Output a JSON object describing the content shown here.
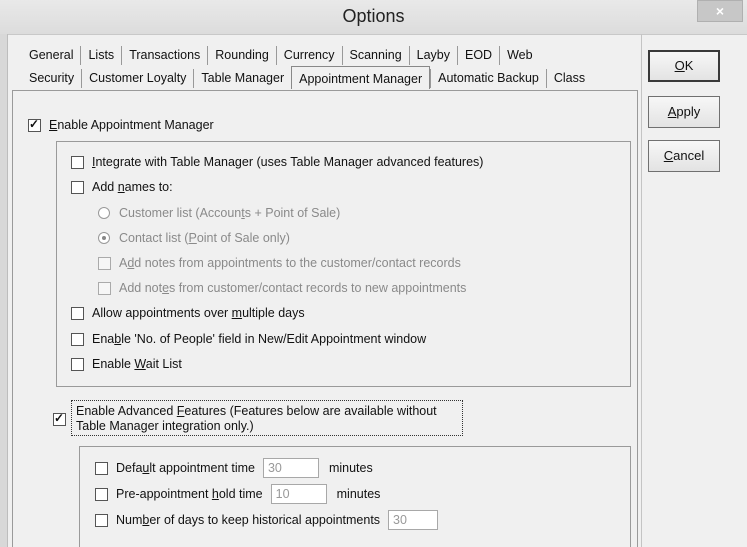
{
  "window": {
    "title": "Options",
    "close_label": "×"
  },
  "tabs_row1": [
    "General",
    "Lists",
    "Transactions",
    "Rounding",
    "Currency",
    "Scanning",
    "Layby",
    "EOD",
    "Web"
  ],
  "tabs_row2": [
    "Security",
    "Customer Loyalty",
    "Table Manager",
    "Appointment Manager",
    "Automatic Backup",
    "Class"
  ],
  "active_tab": "Appointment Manager",
  "buttons": {
    "ok_pre": "",
    "ok_u": "O",
    "ok_post": "K",
    "apply_pre": "",
    "apply_u": "A",
    "apply_post": "pply",
    "cancel_pre": "",
    "cancel_u": "C",
    "cancel_post": "ancel"
  },
  "enable_appt": {
    "checked": true,
    "pre": "",
    "u": "E",
    "post": "nable Appointment Manager"
  },
  "integrate": {
    "checked": false,
    "pre": "",
    "u": "I",
    "post": "ntegrate with Table Manager (uses Table Manager advanced features)"
  },
  "add_names": {
    "checked": false,
    "pre": "Add ",
    "u": "n",
    "post": "ames to:"
  },
  "customer_list": {
    "selected": false,
    "pre": "Customer list (Accoun",
    "u": "t",
    "post": "s + Point of Sale)"
  },
  "contact_list": {
    "selected": true,
    "pre": "Contact list (",
    "u": "P",
    "post": "oint of Sale only)"
  },
  "notes_to_records": {
    "checked": false,
    "pre": "A",
    "u": "d",
    "post": "d notes from appointments to the customer/contact records"
  },
  "notes_from_records": {
    "checked": false,
    "pre": "Add not",
    "u": "e",
    "post": "s from customer/contact records to new appointments"
  },
  "multi_days": {
    "checked": false,
    "pre": "Allow appointments over ",
    "u": "m",
    "post": "ultiple days"
  },
  "no_people": {
    "checked": false,
    "pre": "Ena",
    "u": "b",
    "post": "le 'No. of People' field in New/Edit Appointment window"
  },
  "wait_list": {
    "checked": false,
    "pre": "Enable ",
    "u": "W",
    "post": "ait List"
  },
  "advanced": {
    "checked": true,
    "line1_pre": "Enable Advanced ",
    "line1_u": "F",
    "line1_post": "eatures (Features below are available without",
    "line2": "Table Manager integration only.)"
  },
  "default_time": {
    "checked": false,
    "pre": "Defa",
    "u": "u",
    "post": "lt appointment time",
    "value": "30",
    "unit": "minutes"
  },
  "hold_time": {
    "checked": false,
    "pre": "Pre-appointment ",
    "u": "h",
    "post": "old time",
    "value": "10",
    "unit": "minutes"
  },
  "history_days": {
    "checked": false,
    "pre": "Num",
    "u": "b",
    "post": "er of days to keep historical appointments",
    "value": "30"
  }
}
